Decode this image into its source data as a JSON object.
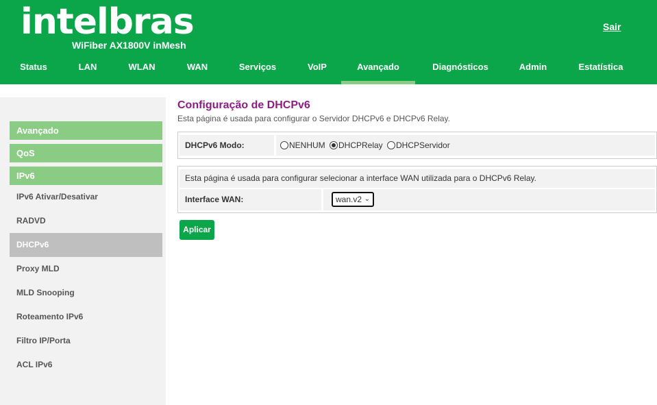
{
  "header": {
    "logo": "intelbras",
    "model": "WiFiber AX1800V inMesh",
    "logout_label": "Sair"
  },
  "nav": {
    "items": [
      "Status",
      "LAN",
      "WLAN",
      "WAN",
      "Serviços",
      "VoIP",
      "Avançado",
      "Diagnósticos",
      "Admin",
      "Estatística"
    ],
    "active": "Avançado"
  },
  "sidebar": {
    "headers": [
      "Avançado",
      "QoS",
      "IPv6"
    ],
    "items": [
      "IPv6 Ativar/Desativar",
      "RADVD",
      "DHCPv6",
      "Proxy MLD",
      "MLD Snooping",
      "Roteamento IPv6",
      "Filtro IP/Porta",
      "ACL IPv6"
    ],
    "active": "DHCPv6"
  },
  "page": {
    "title": "Configuração de DHCPv6",
    "description": "Esta página é usada para configurar o Servidor DHCPv6 e DHCPv6 Relay."
  },
  "mode": {
    "label": "DHCPv6 Modo:",
    "options": [
      "NENHUM",
      "DHCPRelay",
      "DHCPServidor"
    ],
    "selected": "DHCPRelay"
  },
  "relay": {
    "description": "Esta página é usada para configurar selecionar a interface WAN utilizada para o DHCPv6 Relay.",
    "wan_label": "Interface WAN:",
    "wan_value": "wan.v2"
  },
  "actions": {
    "apply_label": "Aplicar"
  },
  "colors": {
    "brand_green": "#0ca64a",
    "light_green": "#8bcc85",
    "title_purple": "#8b1e84"
  }
}
